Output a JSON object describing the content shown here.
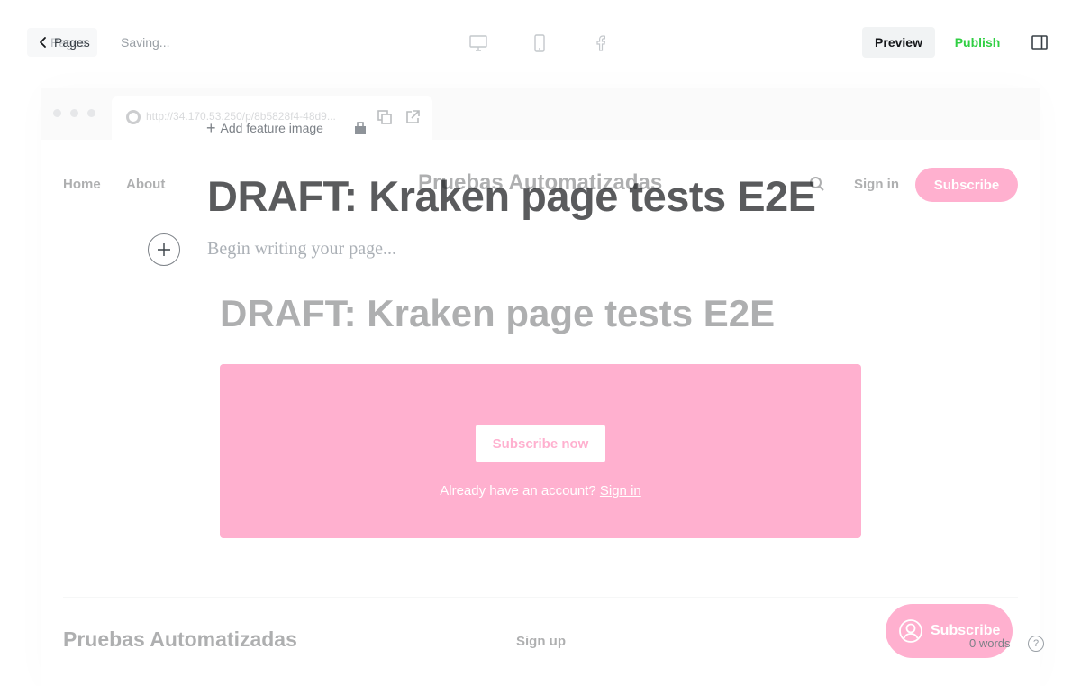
{
  "toolbar": {
    "back_ghost_label": "Pages",
    "back_label": "Pages",
    "status": "Saving...",
    "preview_label": "Preview",
    "publish_label": "Publish"
  },
  "preview": {
    "url": "http://34.170.53.250/p/8b5828f4-48d9...",
    "nav": {
      "home": "Home",
      "about": "About",
      "brand": "Pruebas Automatizadas",
      "signin": "Sign in",
      "subscribe": "Subscribe"
    },
    "title": "DRAFT: Kraken page tests E2E",
    "cta": {
      "button": "Subscribe now",
      "text": "Already have an account?",
      "link": "Sign in"
    },
    "footer": {
      "brand": "Pruebas Automatizadas",
      "signup": "Sign up"
    },
    "portal_button": "Subscribe"
  },
  "editor": {
    "feature_image_label": "Add feature image",
    "title": "DRAFT: Kraken page tests E2E",
    "body_placeholder": "Begin writing your page...",
    "word_count": "0 words",
    "help": "?"
  },
  "colors": {
    "accent": "#ff1a75",
    "publish": "#30cf43"
  }
}
